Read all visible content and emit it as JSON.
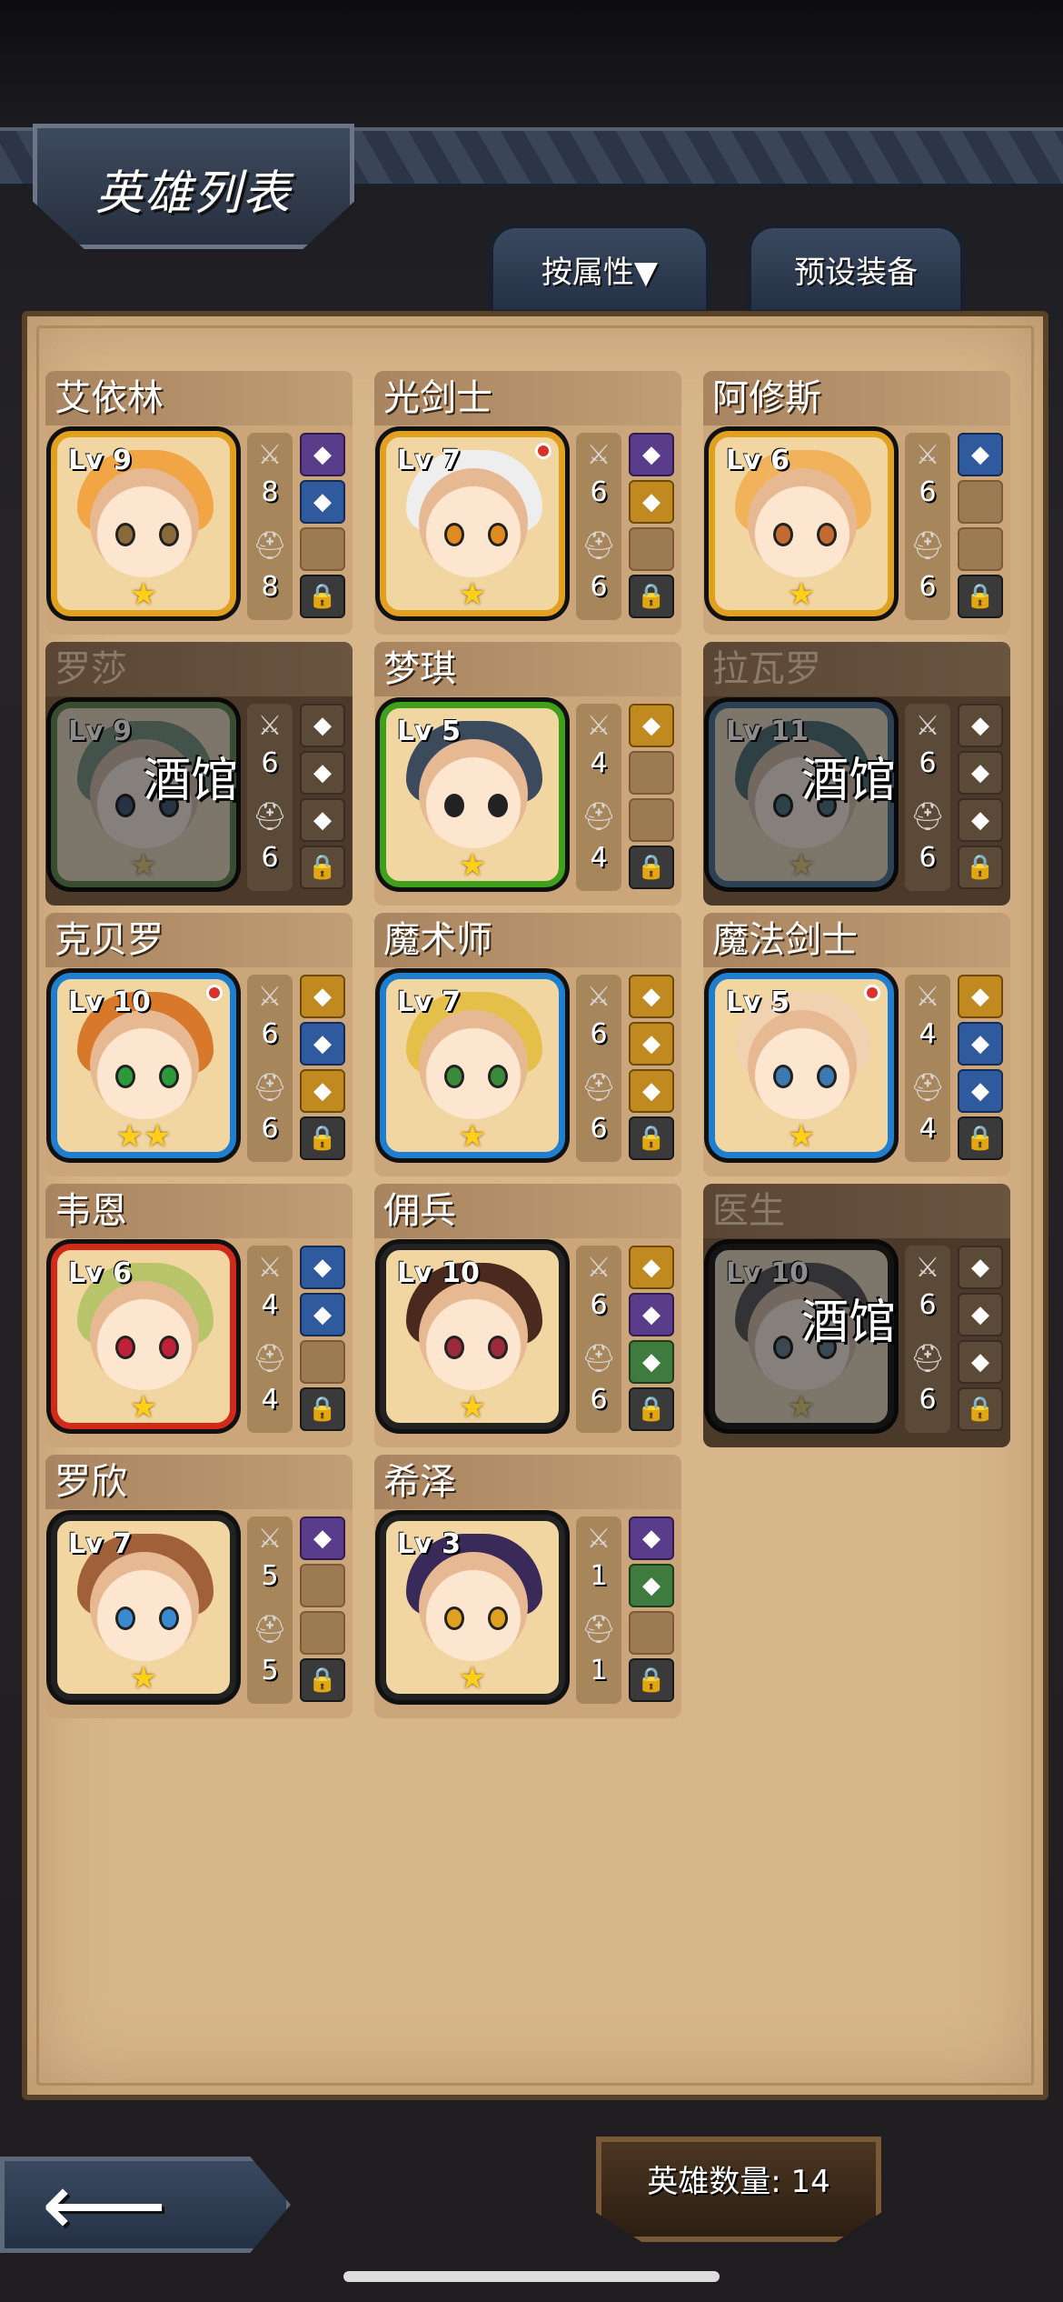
{
  "header": {
    "title": "英雄列表"
  },
  "tabs": [
    {
      "label": "按属性▼"
    },
    {
      "label": "预设装备"
    }
  ],
  "tavern_label": "酒馆",
  "heroes": [
    {
      "name": "艾依林",
      "level": "Lv 9",
      "attack": "8",
      "defense": "8",
      "stars": 1,
      "frame": "yellow",
      "status": "active",
      "hair": "#f2a544",
      "eye": "#8a6a3a"
    },
    {
      "name": "光剑士",
      "level": "Lv 7",
      "attack": "6",
      "defense": "6",
      "stars": 1,
      "frame": "yellow",
      "status": "active",
      "hair": "#eeeeee",
      "eye": "#e08a20",
      "notify": true
    },
    {
      "name": "阿修斯",
      "level": "Lv 6",
      "attack": "6",
      "defense": "6",
      "stars": 1,
      "frame": "yellow",
      "status": "active",
      "hair": "#f1b25c",
      "eye": "#c26a30"
    },
    {
      "name": "罗莎",
      "level": "Lv 9",
      "attack": "6",
      "defense": "6",
      "stars": 1,
      "frame": "green",
      "status": "tavern",
      "hair": "#5aa07a",
      "eye": "#2b5ea8"
    },
    {
      "name": "梦琪",
      "level": "Lv 5",
      "attack": "4",
      "defense": "4",
      "stars": 1,
      "frame": "green",
      "status": "active",
      "hair": "#3c4a5e",
      "eye": "#222222"
    },
    {
      "name": "拉瓦罗",
      "level": "Lv 11",
      "attack": "6",
      "defense": "6",
      "stars": 1,
      "frame": "blue",
      "status": "tavern",
      "hair": "#2a7f8e",
      "eye": "#2b7fa8"
    },
    {
      "name": "克贝罗",
      "level": "Lv 10",
      "attack": "6",
      "defense": "6",
      "stars": 2,
      "frame": "blue",
      "status": "active",
      "hair": "#d8782a",
      "eye": "#2a9a3a",
      "notify": true
    },
    {
      "name": "魔术师",
      "level": "Lv 7",
      "attack": "6",
      "defense": "6",
      "stars": 1,
      "frame": "blue",
      "status": "active",
      "hair": "#e4c04a",
      "eye": "#3a8a3a"
    },
    {
      "name": "魔法剑士",
      "level": "Lv 5",
      "attack": "4",
      "defense": "4",
      "stars": 1,
      "frame": "blue",
      "status": "active",
      "hair": "#f0d2b0",
      "eye": "#3a7ab0",
      "notify": true
    },
    {
      "name": "韦恩",
      "level": "Lv 6",
      "attack": "4",
      "defense": "4",
      "stars": 1,
      "frame": "red",
      "status": "active",
      "hair": "#b8c46a",
      "eye": "#c0203a"
    },
    {
      "name": "佣兵",
      "level": "Lv 10",
      "attack": "6",
      "defense": "6",
      "stars": 1,
      "frame": "black",
      "status": "active",
      "hair": "#4a2a1e",
      "eye": "#9a2a3a"
    },
    {
      "name": "医生",
      "level": "Lv 10",
      "attack": "6",
      "defense": "6",
      "stars": 1,
      "frame": "black",
      "status": "tavern",
      "hair": "#5c5c66",
      "eye": "#4a8ab0"
    },
    {
      "name": "罗欣",
      "level": "Lv 7",
      "attack": "5",
      "defense": "5",
      "stars": 1,
      "frame": "black",
      "status": "active",
      "hair": "#a0603a",
      "eye": "#3a8ad0"
    },
    {
      "name": "希泽",
      "level": "Lv 3",
      "attack": "1",
      "defense": "1",
      "stars": 1,
      "frame": "black",
      "status": "active",
      "hair": "#3a2a5a",
      "eye": "#e0a020"
    }
  ],
  "equipment": [
    [
      "filled",
      "filled blue",
      "",
      ""
    ],
    [
      "filled",
      "filled gold",
      "",
      ""
    ],
    [
      "filled blue",
      "",
      "",
      ""
    ],
    [
      "filled",
      "filled",
      "filled",
      ""
    ],
    [
      "filled gold",
      "",
      "",
      ""
    ],
    [
      "filled",
      "filled",
      "filled",
      ""
    ],
    [
      "filled gold",
      "filled blue",
      "filled gold",
      ""
    ],
    [
      "filled gold",
      "filled gold",
      "filled gold",
      ""
    ],
    [
      "filled gold",
      "filled blue",
      "filled blue",
      ""
    ],
    [
      "filled blue",
      "filled blue",
      "",
      ""
    ],
    [
      "filled gold",
      "filled",
      "filled green",
      ""
    ],
    [
      "filled",
      "filled",
      "filled",
      ""
    ],
    [
      "filled",
      "",
      "",
      ""
    ],
    [
      "filled",
      "filled green",
      "",
      ""
    ]
  ],
  "footer": {
    "hero_count": "英雄数量: 14"
  },
  "icons": {
    "back": "back-arrow-icon",
    "sword": "sword-icon",
    "helmet": "helmet-icon",
    "lock": "lock-icon",
    "star": "star-icon"
  }
}
